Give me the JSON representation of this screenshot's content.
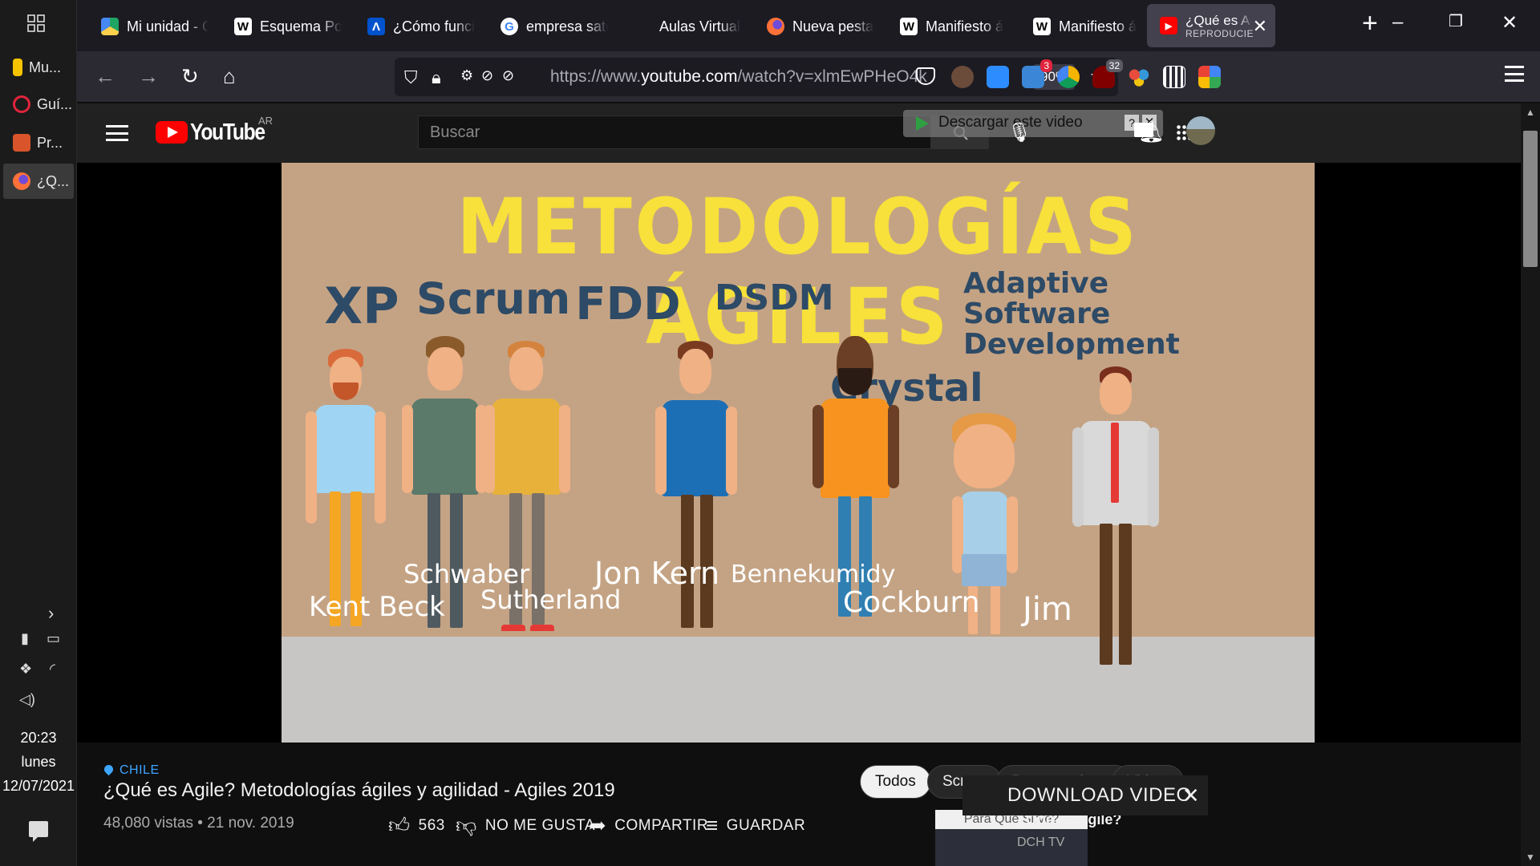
{
  "taskbar": {
    "items": [
      {
        "label": "Mu...",
        "color": "#f5c400"
      },
      {
        "label": "Guí...",
        "color": "#e0243c"
      },
      {
        "label": "Pr...",
        "color": "#d9542b"
      },
      {
        "label": "¿Q...",
        "color": "#ff7139"
      }
    ],
    "clock": {
      "time": "20:23",
      "day": "lunes",
      "date": "12/07/2021"
    }
  },
  "browser": {
    "tabs": [
      {
        "title": "Mi unidad - G",
        "icon": "google-drive-icon"
      },
      {
        "title": "Esquema Por",
        "icon": "wikipedia-icon"
      },
      {
        "title": "¿Cómo funci",
        "icon": "atlassian-icon"
      },
      {
        "title": "empresa sate",
        "icon": "google-icon"
      },
      {
        "title": "Aulas Virtual",
        "icon": "moodle-icon"
      },
      {
        "title": "Nueva pesta",
        "icon": "firefox-icon"
      },
      {
        "title": "Manifiesto á",
        "icon": "wikipedia-icon"
      },
      {
        "title": "Manifiesto á",
        "icon": "wikipedia-icon"
      },
      {
        "title": "¿Qué es A",
        "subtitle": "REPRODUCIE",
        "icon": "youtube-icon",
        "active": true
      }
    ],
    "url_prefix": "https://www.",
    "url_host": "youtube.com",
    "url_path": "/watch?v=xlmEwPHeO4k",
    "zoom": "90%",
    "extension_badges": {
      "shield": "3",
      "ublock": "32"
    }
  },
  "youtube": {
    "logo_text": "YouTube",
    "country_code": "AR",
    "search_placeholder": "Buscar",
    "download_pill": "Descargar este video",
    "download_pill_help": "?",
    "download_pill_close": "✕",
    "video_frame": {
      "title": "METODOLOGÍAS ÁGILES",
      "methods": [
        "XP",
        "Scrum",
        "FDD",
        "DSDM",
        "Crystal",
        "Adaptive Software Development"
      ],
      "people": [
        "Kent Beck",
        "Schwaber",
        "Sutherland",
        "Jon Kern",
        "Bennekumidy",
        "Cockburn",
        "Jim"
      ]
    },
    "location": "CHILE",
    "video_title": "¿Qué es Agile? Metodologías ágiles y agilidad - Agiles 2019",
    "views_date": "48,080 vistas • 21 nov. 2019",
    "likes": "563",
    "dislike_label": "NO ME GUSTA",
    "share_label": "COMPARTIR",
    "save_label": "GUARDAR",
    "chips": [
      "Todos",
      "Scrum",
      "Presentaciones",
      "Videos"
    ],
    "suggestion": {
      "thumb_text": "Para Qué Sirve?",
      "title": "¿Qué es Agile?",
      "channel": "DCH TV"
    },
    "download_video_label": "DOWNLOAD VIDEO",
    "download_video_close": "✕"
  }
}
